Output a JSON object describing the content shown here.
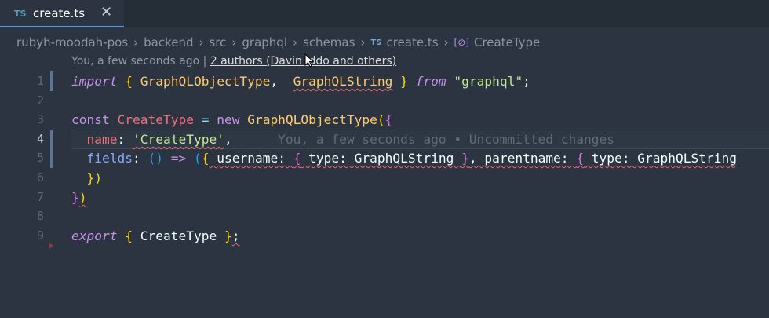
{
  "tab": {
    "lang": "TS",
    "filename": "create.ts",
    "close": "✕"
  },
  "breadcrumb": {
    "items": [
      "rubyh-moodah-pos",
      "backend",
      "src",
      "graphql",
      "schemas"
    ],
    "file_lang": "TS",
    "file": "create.ts",
    "symbol": "CreateType"
  },
  "codelens": {
    "prefix": "You, a few seconds ago |",
    "authors": "2 authors (Davin Iddo and others)"
  },
  "editor": {
    "active_line": 4,
    "lines": [
      {
        "n": "1",
        "t": [
          [
            "kw-i",
            "import"
          ],
          [
            "wh",
            " "
          ],
          [
            "br1",
            "{"
          ],
          [
            "wh",
            " "
          ],
          [
            "ty",
            "GraphQLObjectType"
          ],
          [
            "wh",
            ",  "
          ],
          [
            "ty squig",
            "GraphQLString"
          ],
          [
            "wh",
            " "
          ],
          [
            "br1",
            "}"
          ],
          [
            "wh",
            " "
          ],
          [
            "kw-i",
            "from"
          ],
          [
            "wh",
            " "
          ],
          [
            "st",
            "\"graphql\""
          ],
          [
            "wh",
            ";"
          ]
        ]
      },
      {
        "n": "2",
        "t": []
      },
      {
        "n": "3",
        "t": [
          [
            "kw",
            "const"
          ],
          [
            "wh",
            " "
          ],
          [
            "nm",
            "CreateType"
          ],
          [
            "wh",
            " "
          ],
          [
            "pu",
            "="
          ],
          [
            "wh",
            " "
          ],
          [
            "kw",
            "new"
          ],
          [
            "wh",
            " "
          ],
          [
            "ty",
            "GraphQLObjectType"
          ],
          [
            "br1",
            "("
          ],
          [
            "br2",
            "{"
          ]
        ]
      },
      {
        "n": "4",
        "t": [
          [
            "wh",
            "  "
          ],
          [
            "nm",
            "name"
          ],
          [
            "wh",
            ": "
          ],
          [
            "st squig",
            "'CreateType'"
          ],
          [
            "wh",
            ","
          ],
          [
            "blame",
            "      You, a few seconds ago • Uncommitted changes"
          ]
        ]
      },
      {
        "n": "5",
        "t": [
          [
            "wh",
            "  "
          ],
          [
            "pr",
            "fields"
          ],
          [
            "wh",
            ": "
          ],
          [
            "br3",
            "()"
          ],
          [
            "wh",
            " "
          ],
          [
            "kw",
            "=>"
          ],
          [
            "wh",
            " "
          ],
          [
            "br3",
            "("
          ],
          [
            "br1",
            "{"
          ],
          [
            "wh squig",
            " username: "
          ],
          [
            "br2 squig",
            "{"
          ],
          [
            "wh squig",
            " type: GraphQLString "
          ],
          [
            "br2 squig",
            "}"
          ],
          [
            "wh squig",
            ", parentname: "
          ],
          [
            "br2 squig",
            "{"
          ],
          [
            "wh squig",
            " type: GraphQLString"
          ]
        ]
      },
      {
        "n": "6",
        "t": [
          [
            "wh",
            "  "
          ],
          [
            "br1",
            "})"
          ]
        ]
      },
      {
        "n": "7",
        "t": [
          [
            "br2",
            "}"
          ],
          [
            "br1 squig",
            ")"
          ]
        ]
      },
      {
        "n": "8",
        "t": []
      },
      {
        "n": "9",
        "t": [
          [
            "kw-i",
            "export"
          ],
          [
            "wh",
            " "
          ],
          [
            "br1",
            "{"
          ],
          [
            "wh",
            " "
          ],
          [
            "wh",
            "CreateType"
          ],
          [
            "wh",
            " "
          ],
          [
            "br1",
            "}"
          ],
          [
            "wh squig",
            ";"
          ]
        ]
      }
    ]
  },
  "colors": {
    "background": "#2b3440",
    "accent": "#5b9bd5"
  }
}
